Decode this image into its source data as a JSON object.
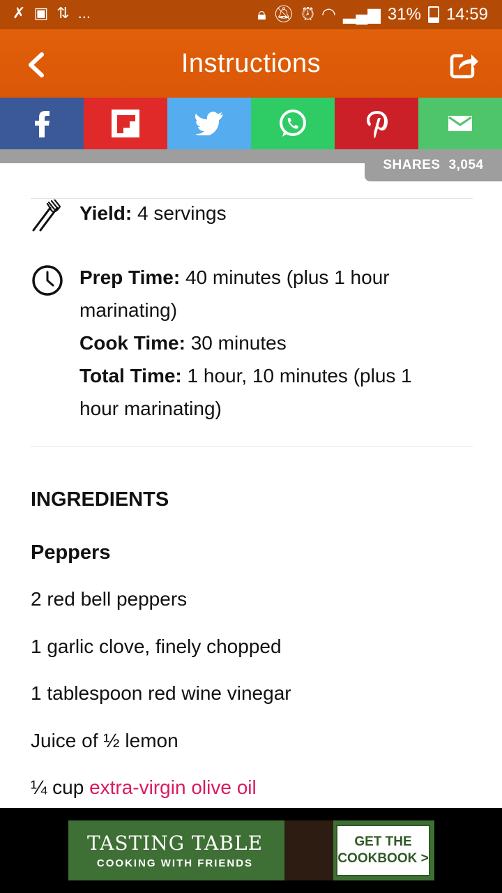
{
  "status_bar": {
    "battery": "31%",
    "time": "14:59",
    "dots": "..."
  },
  "app_bar": {
    "title": "Instructions"
  },
  "share_bar": {
    "buttons": [
      "facebook",
      "flipboard",
      "twitter",
      "whatsapp",
      "pinterest",
      "email"
    ],
    "shares_label": "SHARES",
    "shares_count": "3,054"
  },
  "recipe": {
    "yield_label": "Yield:",
    "yield_value": "4 servings",
    "prep_label": "Prep Time:",
    "prep_value": "40 minutes (plus 1 hour marinating)",
    "cook_label": "Cook Time:",
    "cook_value": "30 minutes",
    "total_label": "Total Time:",
    "total_value": "1 hour, 10 minutes (plus 1 hour marinating)"
  },
  "ingredients": {
    "heading": "INGREDIENTS",
    "group": "Peppers",
    "items": [
      "2 red bell peppers",
      "1 garlic clove, finely chopped",
      "1 tablespoon red wine vinegar",
      "Juice of ½ lemon"
    ],
    "last_prefix": "¼ cup ",
    "last_link": "extra-virgin olive oil"
  },
  "ad": {
    "brand": "TASTING TABLE",
    "tagline": "COOKING WITH FRIENDS",
    "cta_line1": "GET THE",
    "cta_line2": "COOKBOOK >"
  },
  "colors": {
    "app_bar": "#d95707",
    "link": "#d81b60",
    "facebook": "#3b5998",
    "flipboard": "#e02a2a",
    "twitter": "#55acee",
    "whatsapp": "#2fcc66",
    "pinterest": "#cb2027",
    "email": "#4ec56a"
  }
}
